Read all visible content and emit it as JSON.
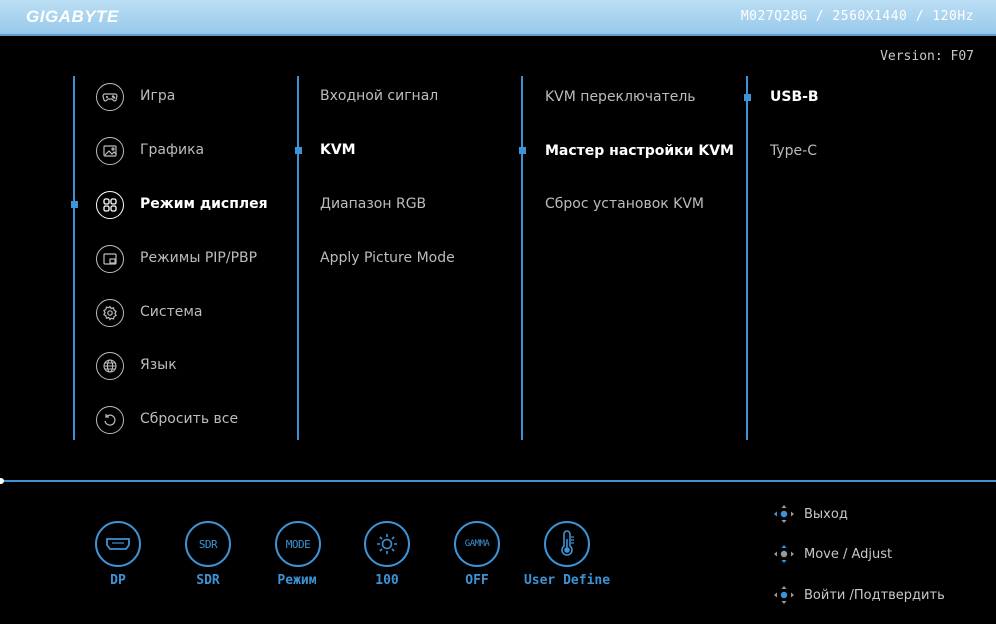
{
  "header": {
    "brand": "GIGABYTE",
    "model_info": "M027Q28G / 2560X1440 / 120Hz",
    "version": "Version: F07"
  },
  "menu_col1": [
    {
      "label": "Игра",
      "icon": "gamepad-icon"
    },
    {
      "label": "Графика",
      "icon": "picture-icon"
    },
    {
      "label": "Режим дисплея",
      "icon": "display-mode-icon",
      "active": true
    },
    {
      "label": "Режимы PIP/PBP",
      "icon": "pip-icon"
    },
    {
      "label": "Система",
      "icon": "gear-icon"
    },
    {
      "label": "Язык",
      "icon": "globe-icon"
    },
    {
      "label": "Сбросить все",
      "icon": "reset-icon"
    }
  ],
  "menu_col2": [
    {
      "label": "Входной сигнал"
    },
    {
      "label": "KVM",
      "active": true
    },
    {
      "label": "Диапазон RGB"
    },
    {
      "label": "Apply Picture Mode"
    }
  ],
  "menu_col3": [
    {
      "label": "KVM переключатель"
    },
    {
      "label": "Мастер настройки KVM",
      "active": true
    },
    {
      "label": "Сброс установок KVM"
    }
  ],
  "menu_col4": [
    {
      "label": "USB-B",
      "active": true
    },
    {
      "label": "Type-C"
    }
  ],
  "quick_settings": [
    {
      "icon_text": "",
      "icon": "hdmi-port-icon",
      "label": "DP"
    },
    {
      "icon_text": "SDR",
      "icon": "sdr-icon",
      "label": "SDR"
    },
    {
      "icon_text": "MODE",
      "icon": "mode-icon",
      "label": "Режим"
    },
    {
      "icon_text": "",
      "icon": "brightness-icon",
      "label": "100"
    },
    {
      "icon_text": "GAMMA",
      "icon": "gamma-icon",
      "label": "OFF"
    },
    {
      "icon_text": "",
      "icon": "thermometer-icon",
      "label": "User Define"
    }
  ],
  "nav_hints": [
    {
      "label": "Выход",
      "icon": "joystick-left-icon"
    },
    {
      "label": "Move / Adjust",
      "icon": "joystick-updown-icon"
    },
    {
      "label": "Войти /Подтвердить",
      "icon": "joystick-press-icon"
    }
  ],
  "colors": {
    "accent": "#3d93d6",
    "topbar": "#a8d4f0",
    "background": "#000000"
  }
}
